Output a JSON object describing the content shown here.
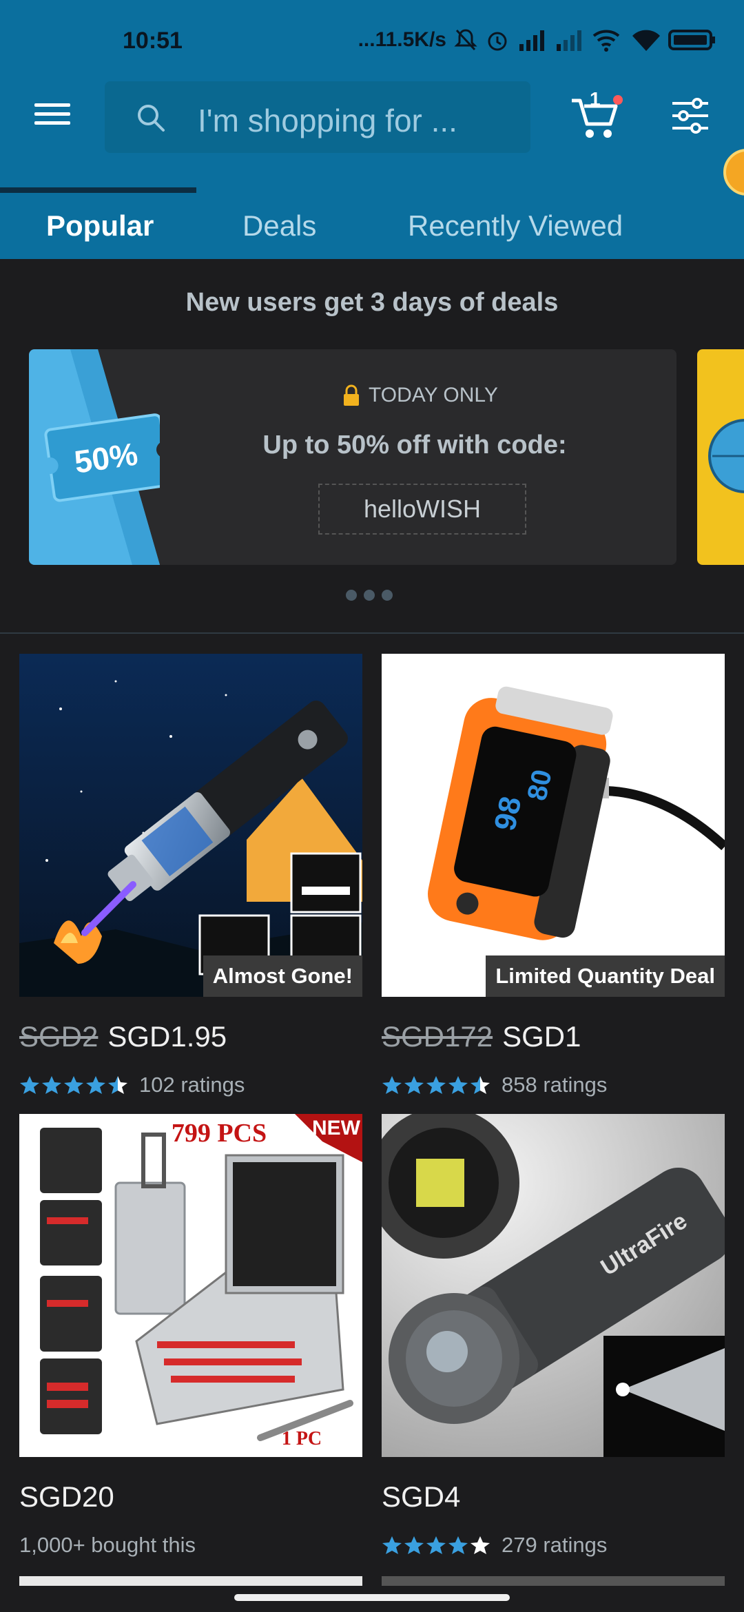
{
  "status_bar": {
    "time": "10:51",
    "network_speed": "...11.5K/s"
  },
  "header": {
    "search_placeholder": "I'm shopping for ...",
    "cart_count": "1"
  },
  "tabs": [
    {
      "label": "Popular",
      "active": true
    },
    {
      "label": "Deals",
      "active": false
    },
    {
      "label": "Recently Viewed",
      "active": false
    }
  ],
  "promo": {
    "heading": "New users get 3 days of deals",
    "coupon_label": "50%",
    "today_label": "TODAY ONLY",
    "offer_text": "Up to 50% off with code:",
    "code": "helloWISH"
  },
  "products": [
    {
      "badge": "Almost Gone!",
      "old_price": "SGD2",
      "price": "SGD1.95",
      "rating": 4.5,
      "ratings_text": "102 ratings"
    },
    {
      "badge": "Limited Quantity Deal",
      "old_price": "SGD172",
      "price": "SGD1",
      "rating": 4.5,
      "ratings_text": "858 ratings"
    },
    {
      "image_text_1": "799 PCS",
      "image_text_2": "NEW",
      "image_text_3": "1 PC",
      "price": "SGD20",
      "subtext": "1,000+ bought this"
    },
    {
      "image_text": "UltraFire",
      "price": "SGD4",
      "rating": 4.0,
      "ratings_text": "279 ratings"
    }
  ],
  "colors": {
    "header_bg": "#0b6f9e",
    "page_bg": "#1c1c1e",
    "star": "#3aa0e0"
  }
}
